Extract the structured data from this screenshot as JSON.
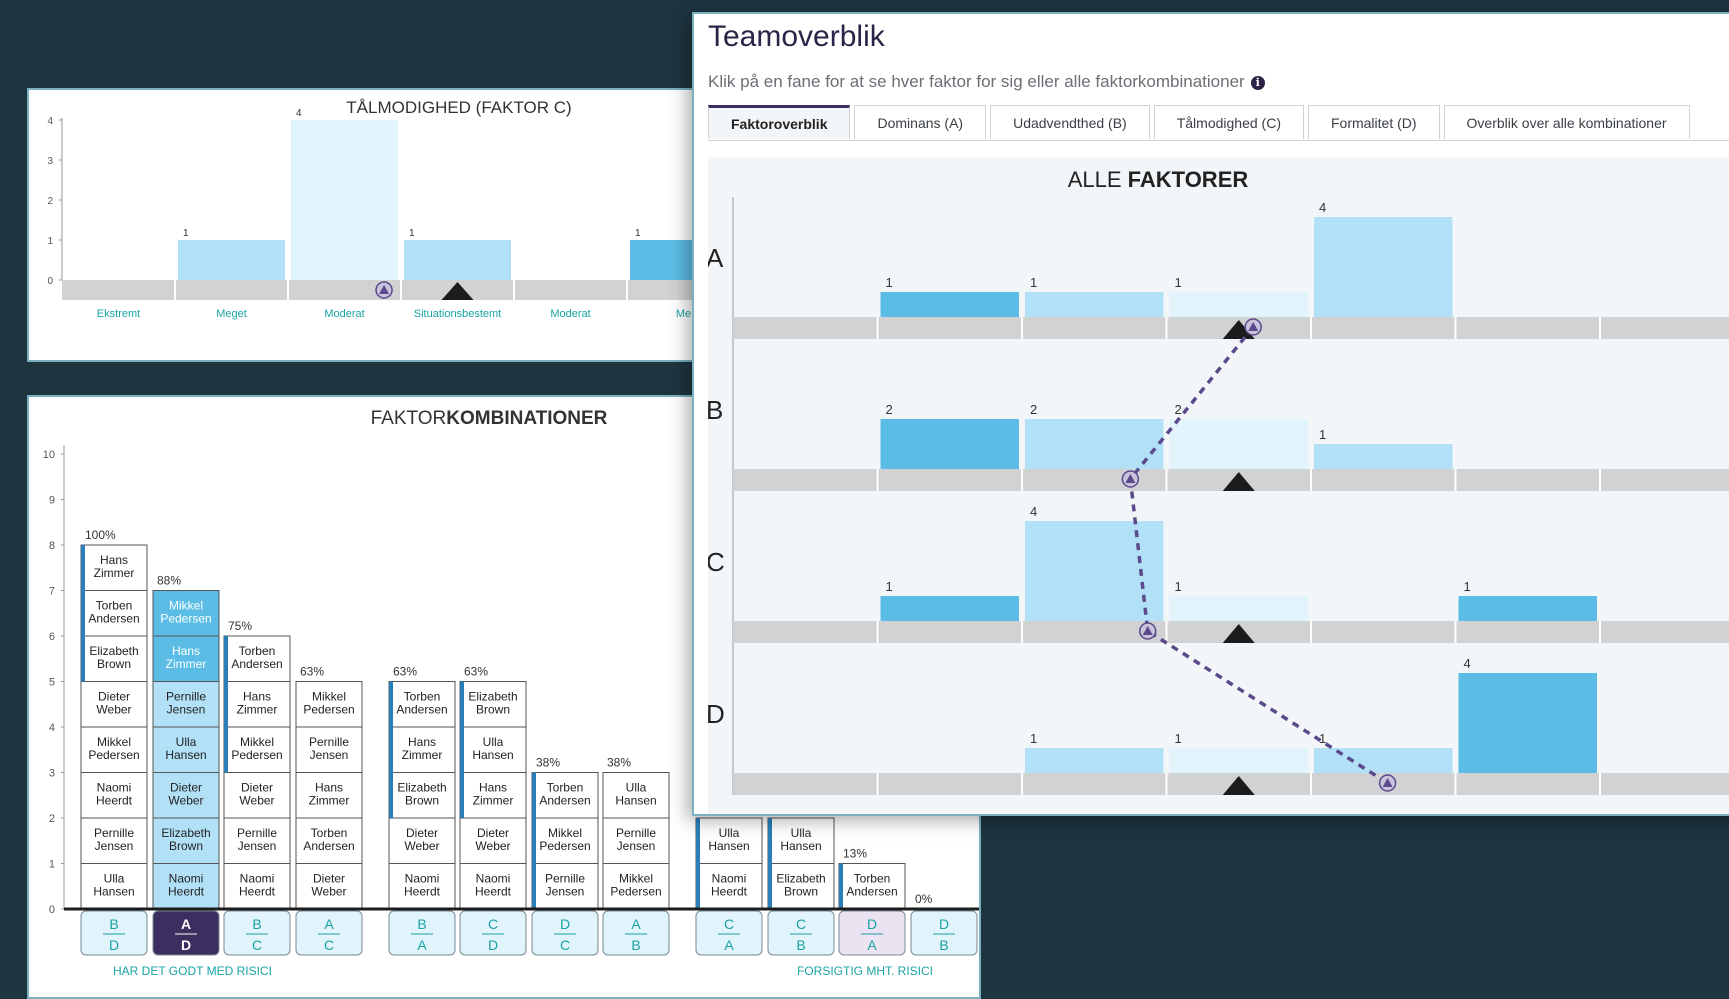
{
  "colors": {
    "bar_dark": "#5bbde6",
    "bar_mid": "#b2e1f7",
    "bar_light": "#e1f3fb",
    "track": "#d0d2d4",
    "ink": "#1c1c1c",
    "purple": "#5a4a8c",
    "teal": "#1aa3a3",
    "dark_cell": "#3c2f5f"
  },
  "patience": {
    "title": "TÅLMODIGHED (FAKTOR C)",
    "y_ticks": [
      "0",
      "1",
      "2",
      "3",
      "4"
    ],
    "categories": [
      "Ekstremt",
      "Meget",
      "Moderat",
      "Situationsbestemt",
      "Moderat",
      "Me"
    ]
  },
  "combos": {
    "title_light": "FAKTOR",
    "title_bold": "KOMBINATIONER",
    "y_ticks": [
      "0",
      "1",
      "2",
      "3",
      "4",
      "5",
      "6",
      "7",
      "8",
      "9",
      "10"
    ],
    "columns": [
      {
        "pct": "100%",
        "top": "B",
        "bottom": "D",
        "names": [
          "Hans Zimmer",
          "Torben Andersen",
          "Elizabeth Brown",
          "Dieter Weber",
          "Mikkel Pedersen",
          "Naomi Heerdt",
          "Pernille Jensen",
          "Ulla Hansen"
        ]
      },
      {
        "pct": "88%",
        "top": "A",
        "bottom": "D",
        "names": [
          "Mikkel Pedersen",
          "Hans Zimmer",
          "Pernille Jensen",
          "Ulla Hansen",
          "Dieter Weber",
          "Elizabeth Brown",
          "Naomi Heerdt"
        ]
      },
      {
        "pct": "75%",
        "top": "B",
        "bottom": "C",
        "names": [
          "Torben Andersen",
          "Hans Zimmer",
          "Mikkel Pedersen",
          "Dieter Weber",
          "Pernille Jensen",
          "Naomi Heerdt"
        ]
      },
      {
        "pct": "63%",
        "top": "A",
        "bottom": "C",
        "names": [
          "Mikkel Pedersen",
          "Pernille Jensen",
          "Hans Zimmer",
          "Torben Andersen",
          "Dieter Weber"
        ]
      },
      {
        "pct": "63%",
        "top": "B",
        "bottom": "A",
        "names": [
          "Torben Andersen",
          "Hans Zimmer",
          "Elizabeth Brown",
          "Dieter Weber",
          "Naomi Heerdt"
        ]
      },
      {
        "pct": "63%",
        "top": "C",
        "bottom": "D",
        "names": [
          "Elizabeth Brown",
          "Ulla Hansen",
          "Hans Zimmer",
          "Dieter Weber",
          "Naomi Heerdt"
        ]
      },
      {
        "pct": "38%",
        "top": "D",
        "bottom": "C",
        "names": [
          "Torben Andersen",
          "Mikkel Pedersen",
          "Pernille Jensen"
        ]
      },
      {
        "pct": "38%",
        "top": "A",
        "bottom": "B",
        "names": [
          "Ulla Hansen",
          "Pernille Jensen",
          "Mikkel Pedersen"
        ]
      },
      {
        "pct": "",
        "top": "C",
        "bottom": "A",
        "names": [
          "Ulla Hansen",
          "Naomi Heerdt"
        ]
      },
      {
        "pct": "",
        "top": "C",
        "bottom": "B",
        "names": [
          "Ulla Hansen",
          "Elizabeth Brown"
        ]
      },
      {
        "pct": "13%",
        "top": "D",
        "bottom": "A",
        "names": [
          "Torben Andersen"
        ]
      },
      {
        "pct": "0%",
        "top": "D",
        "bottom": "B",
        "names": []
      }
    ],
    "footer_left": "HAR DET GODT MED RISICI",
    "footer_right": "FORSIGTIG MHT. RISICI"
  },
  "team": {
    "title": "Teamoverblik",
    "subtitle": "Klik på en fane for at se hver faktor for sig eller alle faktorkombinationer",
    "tabs": [
      "Faktoroverblik",
      "Dominans (A)",
      "Udadvendthed (B)",
      "Tålmodighed (C)",
      "Formalitet (D)",
      "Overblik over alle kombinationer"
    ],
    "chart_title_light": "ALLE ",
    "chart_title_bold": "FAKTORER"
  },
  "chart_data": [
    {
      "type": "bar",
      "title": "TÅLMODIGHED (FAKTOR C)",
      "categories": [
        "Ekstremt",
        "Meget",
        "Moderat",
        "Situationsbestemt",
        "Moderat",
        "Me"
      ],
      "values": [
        0,
        1,
        4,
        1,
        0,
        1
      ],
      "ylim": [
        0,
        4
      ],
      "marker_bin": 2.85,
      "triangle_bin": 3.5
    },
    {
      "type": "bar",
      "title": "ALLE FAKTORER",
      "categories": [
        "A",
        "B",
        "C",
        "D"
      ],
      "series": [
        {
          "name": "A",
          "values": [
            0,
            1,
            1,
            1,
            4,
            0,
            0
          ]
        },
        {
          "name": "B",
          "values": [
            0,
            2,
            2,
            2,
            1,
            0,
            0
          ]
        },
        {
          "name": "C",
          "values": [
            0,
            1,
            4,
            1,
            0,
            1,
            0
          ]
        },
        {
          "name": "D",
          "values": [
            0,
            0,
            1,
            1,
            1,
            4,
            0
          ]
        }
      ],
      "ylim": [
        0,
        4
      ],
      "marker_bins": [
        3.6,
        2.75,
        2.87,
        4.53
      ],
      "triangle_bin": 3.5
    }
  ]
}
